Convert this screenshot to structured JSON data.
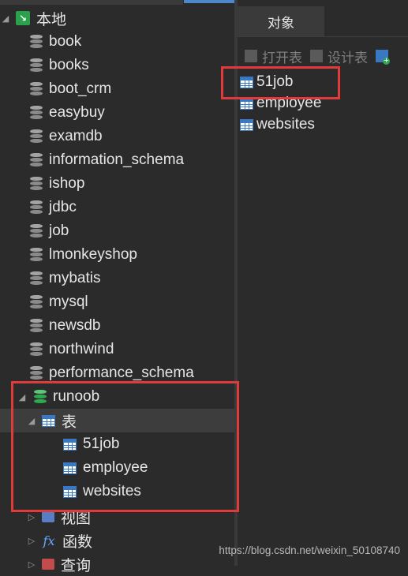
{
  "connection": {
    "label": "本地"
  },
  "databases": [
    "book",
    "books",
    "boot_crm",
    "easybuy",
    "examdb",
    "information_schema",
    "ishop",
    "jdbc",
    "job",
    "lmonkeyshop",
    "mybatis",
    "mysql",
    "newsdb",
    "northwind",
    "performance_schema"
  ],
  "active_db": {
    "label": "runoob"
  },
  "tables_node": {
    "label": "表"
  },
  "tables": [
    "51job",
    "employee",
    "websites"
  ],
  "other_nodes": [
    {
      "label": "视图"
    },
    {
      "label": "函数"
    },
    {
      "label": "查询"
    }
  ],
  "right_panel": {
    "tab_label": "对象",
    "toolbar": {
      "open_table": "打开表",
      "design_table": "设计表"
    },
    "objects": [
      "51job",
      "employee",
      "websites"
    ]
  },
  "watermark": "https://blog.csdn.net/weixin_50108740",
  "colors": {
    "highlight": "#e03a3a",
    "accent": "#4e88c9",
    "db_active": "#2fa84f"
  }
}
